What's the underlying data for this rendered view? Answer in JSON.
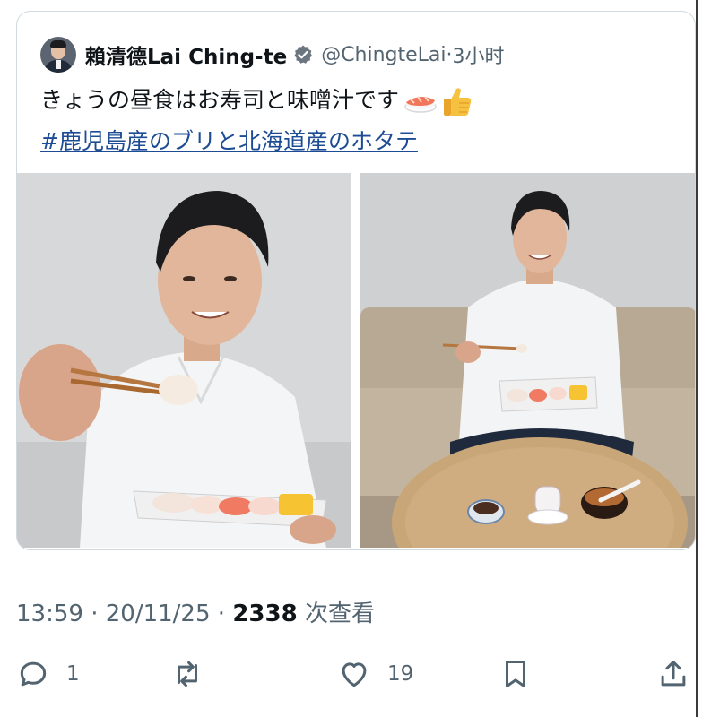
{
  "quoted_tweet": {
    "display_name": "賴清德Lai Ching-te",
    "handle": "@ChingteLai",
    "separator": "·",
    "time_ago": "3小时",
    "text": "きょうの昼食はお寿司と味噌汁です",
    "emojis": [
      "sushi-icon",
      "thumbs-up-icon"
    ],
    "hashtag": "#鹿児島産のブリと北海道産のホタテ"
  },
  "tweet_meta": {
    "time": "13:59",
    "sep1": "·",
    "date": "20/11/25",
    "sep2": "·",
    "views_count": "2338",
    "views_label": "次查看"
  },
  "actions": {
    "reply_count": "1",
    "retweet_count": "",
    "like_count": "19"
  },
  "colors": {
    "link": "#1d4c94",
    "secondary_text": "#536471",
    "verified": "#6b7580",
    "border": "#cfd9de"
  }
}
